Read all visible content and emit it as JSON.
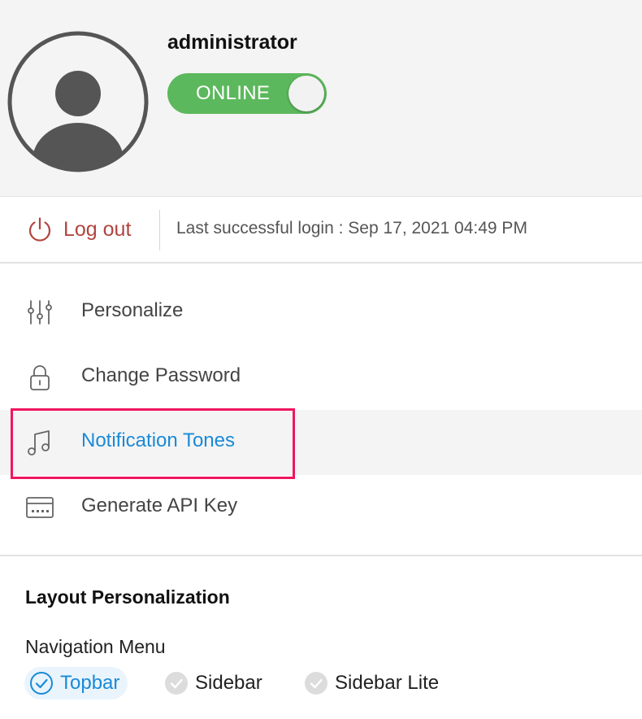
{
  "profile": {
    "username": "administrator",
    "status_toggle": {
      "label": "ONLINE",
      "on": true,
      "color": "#5cb85c"
    }
  },
  "session": {
    "logout_label": "Log out",
    "last_login": "Last successful login : Sep 17, 2021 04:49 PM"
  },
  "menu": {
    "items": [
      {
        "label": "Personalize",
        "icon": "sliders-icon"
      },
      {
        "label": "Change Password",
        "icon": "lock-icon"
      },
      {
        "label": "Notification Tones",
        "icon": "music-note-icon",
        "active": true
      },
      {
        "label": "Generate API Key",
        "icon": "keyboard-icon"
      }
    ]
  },
  "layout_personalization": {
    "title": "Layout Personalization",
    "navigation_menu": {
      "label": "Navigation Menu",
      "options": [
        {
          "label": "Topbar",
          "selected": true
        },
        {
          "label": "Sidebar",
          "selected": false
        },
        {
          "label": "Sidebar Lite",
          "selected": false
        }
      ]
    }
  },
  "colors": {
    "accent": "#1a8ad6",
    "logout": "#b1453f",
    "highlight_box": "#f0165e",
    "header_bg": "#f4f4f4"
  }
}
